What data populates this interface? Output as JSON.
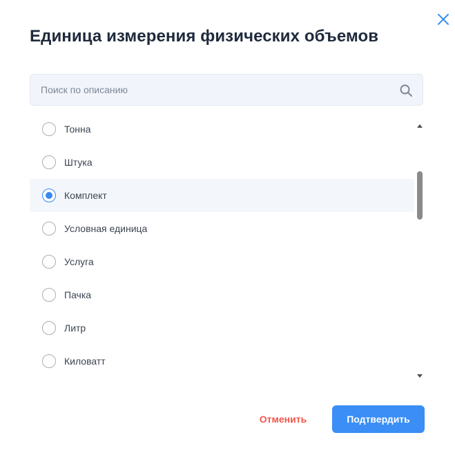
{
  "dialog": {
    "title": "Единица измерения физических объемов",
    "close_icon": "close-icon"
  },
  "search": {
    "placeholder": "Поиск по описанию",
    "value": "",
    "icon": "search-icon"
  },
  "options": [
    {
      "label": "Тонна",
      "selected": false
    },
    {
      "label": "Штука",
      "selected": false
    },
    {
      "label": "Комплект",
      "selected": true
    },
    {
      "label": "Условная единица",
      "selected": false
    },
    {
      "label": "Услуга",
      "selected": false
    },
    {
      "label": "Пачка",
      "selected": false
    },
    {
      "label": "Литр",
      "selected": false
    },
    {
      "label": "Киловатт",
      "selected": false
    }
  ],
  "footer": {
    "cancel_label": "Отменить",
    "confirm_label": "Подтвердить"
  },
  "colors": {
    "accent": "#3a8ef5",
    "cancel": "#f0564b",
    "title": "#1f2a3c",
    "selected_row": "#f3f7fc"
  }
}
